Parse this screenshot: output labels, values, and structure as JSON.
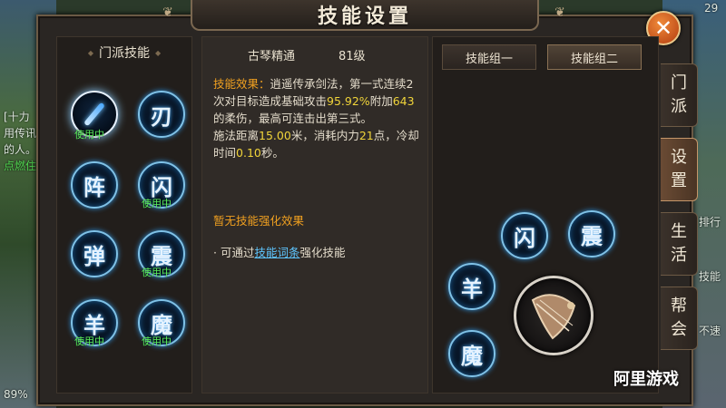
{
  "background": {
    "left_lines": [
      "[十力",
      "用传讯",
      "的人。",
      "点燃住"
    ],
    "battery": "89%",
    "time_fragment": "29",
    "right_fragments": [
      "排行",
      "技能",
      "不速"
    ]
  },
  "title": "技能设置",
  "close_symbol": "✕",
  "left_panel": {
    "header": "门派技能",
    "in_use_label": "使用中",
    "skills": [
      {
        "glyph": "",
        "icon": "sword-icon",
        "in_use": true
      },
      {
        "glyph": "刃",
        "in_use": false
      },
      {
        "glyph": "阵",
        "in_use": false
      },
      {
        "glyph": "闪",
        "in_use": true
      },
      {
        "glyph": "弹",
        "in_use": false
      },
      {
        "glyph": "震",
        "in_use": true
      },
      {
        "glyph": "羊",
        "in_use": true
      },
      {
        "glyph": "魔",
        "in_use": true
      }
    ]
  },
  "detail": {
    "skill_name": "古琴精通",
    "skill_level": "81级",
    "effect_label": "技能效果：",
    "effect_text_1": "逍遥传承剑法，第一式连续2次对目标造成基础攻击",
    "effect_pct": "95.92%",
    "effect_text_2": "附加",
    "effect_num": "643",
    "effect_text_3": "的柔伤，最高可连击出第三式。",
    "range_text_1": "施法距离",
    "range_value": "15.00",
    "range_text_2": "米，消耗内力",
    "cost_value": "21",
    "range_text_3": "点，冷却时间",
    "cooldown_value": "0.10",
    "range_text_4": "秒。",
    "enhance_title": "暂无技能强化效果",
    "enhance_prefix": "· 可通过",
    "enhance_link": "技能词条",
    "enhance_suffix": "强化技能"
  },
  "right_panel": {
    "group1": "技能组一",
    "group2": "技能组二",
    "equipped": [
      {
        "glyph": "闪"
      },
      {
        "glyph": "震"
      },
      {
        "glyph": "羊"
      },
      {
        "glyph": "魔"
      }
    ],
    "weapon_icon": "guqin-weapon-icon"
  },
  "tabs": [
    "门派",
    "设置",
    "生活",
    "帮会"
  ],
  "active_tab": "设置",
  "watermark": "阿里游戏",
  "colors": {
    "accent_orange": "#f0a020",
    "highlight_yellow": "#f0d43a",
    "in_use_green": "#5cf05c",
    "link_blue": "#5ec6ff"
  }
}
